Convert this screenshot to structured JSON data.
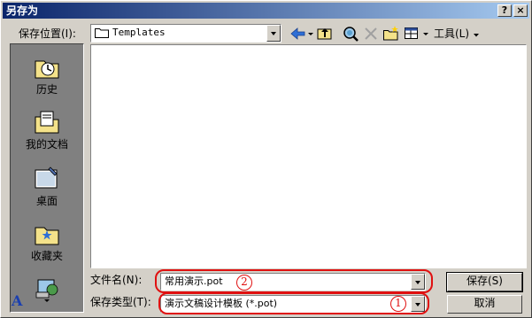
{
  "window": {
    "title": "另存为",
    "help_label": "?",
    "close_label": "×"
  },
  "location": {
    "label": "保存位置(I):",
    "value": "Templates"
  },
  "toolbar": {
    "tools_label": "工具(L)"
  },
  "places": [
    {
      "label": "历史",
      "icon": "history-icon"
    },
    {
      "label": "我的文档",
      "icon": "my-documents-icon"
    },
    {
      "label": "桌面",
      "icon": "desktop-icon"
    },
    {
      "label": "收藏夹",
      "icon": "favorites-icon"
    },
    {
      "label": "",
      "icon": "web-folders-icon"
    }
  ],
  "filename": {
    "label": "文件名(N):",
    "value": "常用演示.pot",
    "marker": "2"
  },
  "filetype": {
    "label": "保存类型(T):",
    "value": "演示文稿设计模板 (*.pot)",
    "marker": "1"
  },
  "buttons": {
    "save": "保存(S)",
    "cancel": "取消"
  },
  "colors": {
    "titlebar_start": "#0a246a",
    "titlebar_end": "#a6caf0",
    "callout": "#e01010",
    "dialog_bg": "#d4d0c8"
  }
}
